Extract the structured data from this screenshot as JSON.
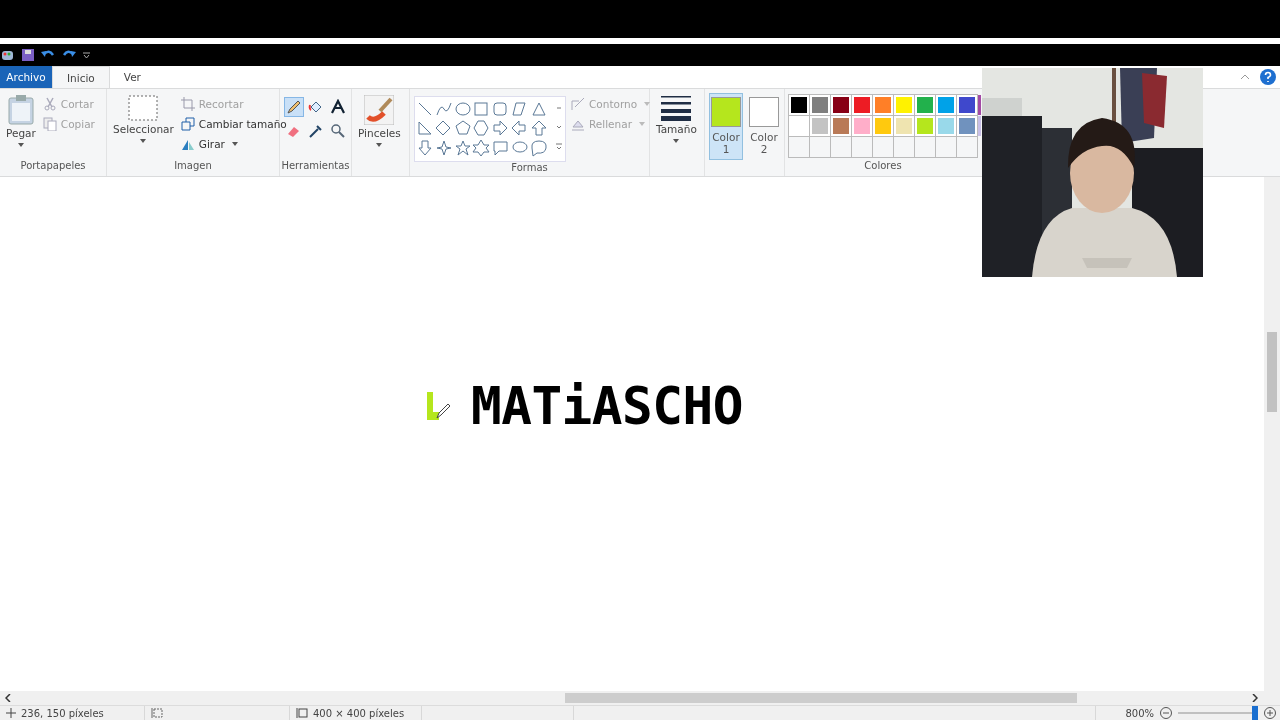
{
  "file_tab": "Archivo",
  "tabs": [
    {
      "label": "Inicio",
      "selected": true
    },
    {
      "label": "Ver",
      "selected": false
    }
  ],
  "clipboard": {
    "paste": "Pegar",
    "items": [
      {
        "label": "Cortar",
        "disabled": true
      },
      {
        "label": "Copiar",
        "disabled": true
      }
    ],
    "group": "Portapapeles"
  },
  "image": {
    "select": "Seleccionar",
    "items": [
      {
        "label": "Recortar",
        "disabled": true
      },
      {
        "label": "Cambiar tamaño",
        "disabled": false
      },
      {
        "label": "Girar",
        "disabled": false
      }
    ],
    "group": "Imagen"
  },
  "tools": {
    "items": [
      {
        "selected": true
      },
      {
        "selected": false
      },
      {
        "selected": false
      },
      {
        "selected": false
      },
      {
        "selected": false
      },
      {
        "selected": false
      }
    ],
    "group": "Herramientas"
  },
  "brushes": "Pinceles",
  "shapes": {
    "options": [
      {
        "label": "Contorno",
        "disabled": true
      },
      {
        "label": "Rellenar",
        "disabled": true
      }
    ],
    "group": "Formas"
  },
  "size": "Tamaño",
  "color_slots": [
    {
      "label": "Color",
      "number": "1",
      "color": "#b5e61d",
      "selected": true
    },
    {
      "label": "Color",
      "number": "2",
      "color": "#ffffff",
      "selected": false
    }
  ],
  "palette": {
    "rows": [
      [
        {
          "color": "#000000"
        },
        {
          "color": "#7f7f7f"
        },
        {
          "color": "#880015"
        },
        {
          "color": "#ed1c24"
        },
        {
          "color": "#ff7f27"
        },
        {
          "color": "#fff200"
        },
        {
          "color": "#22b14c"
        },
        {
          "color": "#00a2e8"
        },
        {
          "color": "#3f48cc"
        },
        {
          "color": "#a349a4"
        }
      ],
      [
        {
          "color": "#ffffff"
        },
        {
          "color": "#c3c3c3"
        },
        {
          "color": "#b97a57"
        },
        {
          "color": "#ffaec9"
        },
        {
          "color": "#ffc90e"
        },
        {
          "color": "#efe4b0"
        },
        {
          "color": "#b5e61d"
        },
        {
          "color": "#99d9ea"
        },
        {
          "color": "#7092be"
        },
        {
          "color": "#c8bfe7"
        }
      ]
    ],
    "group": "Colores"
  },
  "canvas": {
    "text": "MATiASCHO"
  },
  "status": {
    "position": "236, 150 píxeles",
    "size": "400 × 400 píxeles",
    "zoom": "800%"
  },
  "zoom_slider": {
    "level": 0.96
  }
}
